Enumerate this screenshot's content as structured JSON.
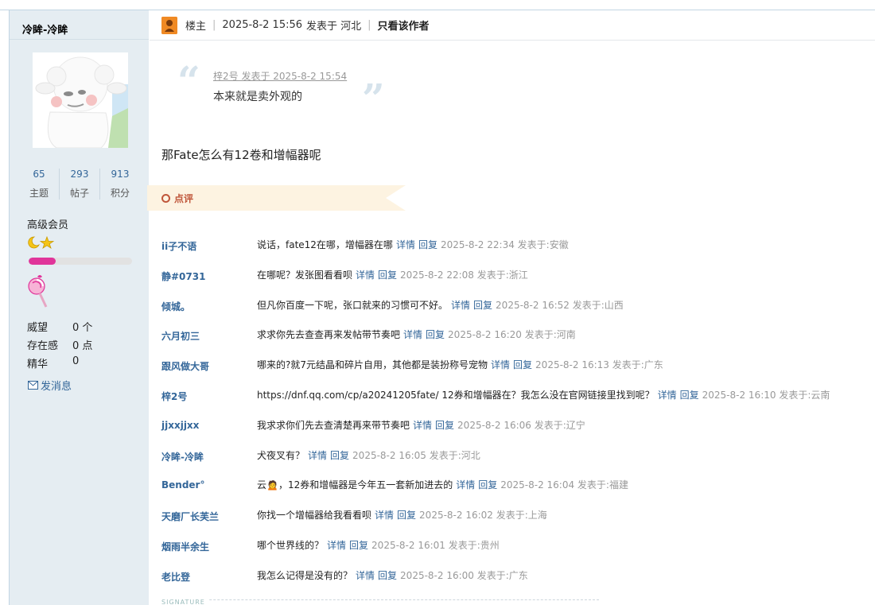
{
  "sidebar": {
    "username": "冷眸-冷眸",
    "stats": [
      {
        "value": "65",
        "label": "主题"
      },
      {
        "value": "293",
        "label": "帖子"
      },
      {
        "value": "913",
        "label": "积分"
      }
    ],
    "level": "高级会员",
    "progress_fraction": 0.26,
    "info": [
      {
        "key": "威望",
        "value": "0 个"
      },
      {
        "key": "存在感",
        "value": "0 点"
      },
      {
        "key": "精华",
        "value": "0"
      }
    ],
    "send_message": "发消息",
    "accent_color": "#e0359a"
  },
  "post_header": {
    "role": "楼主",
    "datetime": "2025-8-2 15:56",
    "posted_from": "发表于 河北",
    "only_author": "只看该作者"
  },
  "quote": {
    "meta": "梓2号 发表于 2025-8-2 15:54",
    "text": "本来就是卖外观的"
  },
  "post_text": "那Fate怎么有12卷和增幅器呢",
  "comment_tab": "点评",
  "comments": [
    {
      "user": "ii子不语",
      "text": "说话，fate12在哪，增幅器在哪",
      "detail": "详情",
      "reply": "回复",
      "time": "2025-8-2 22:34 发表于:安徽"
    },
    {
      "user": "静#0731",
      "text": "在哪呢？发张图看看呗",
      "detail": "详情",
      "reply": "回复",
      "time": "2025-8-2 22:08 发表于:浙江"
    },
    {
      "user": "倾城。",
      "text": "但凡你百度一下呢，张口就来的习惯可不好。",
      "detail": "详情",
      "reply": "回复",
      "time": "2025-8-2 16:52 发表于:山西"
    },
    {
      "user": "六月初三",
      "text": "求求你先去查查再来发帖带节奏吧",
      "detail": "详情",
      "reply": "回复",
      "time": "2025-8-2 16:20 发表于:河南"
    },
    {
      "user": "跟风做大哥",
      "text": "哪来的?就7元结晶和碎片自用，其他都是装扮称号宠物",
      "detail": "详情",
      "reply": "回复",
      "time": "2025-8-2 16:13 发表于:广东"
    },
    {
      "user": "梓2号",
      "text": "https://dnf.qq.com/cp/a20241205fate/ 12券和增幅器在？我怎么没在官网链接里找到呢？",
      "detail": "详情",
      "reply": "回复",
      "time": "2025-8-2 16:10 发表于:云南"
    },
    {
      "user": "jjxxjjxx",
      "text": "我求求你们先去查清楚再来带节奏吧",
      "detail": "详情",
      "reply": "回复",
      "time": "2025-8-2 16:06 发表于:辽宁"
    },
    {
      "user": "冷眸-冷眸",
      "text": "犬夜叉有？",
      "detail": "详情",
      "reply": "回复",
      "time": "2025-8-2 16:05 发表于:河北"
    },
    {
      "user": "Bender°",
      "text": "云🙍，12券和增幅器是今年五一套新加进去的",
      "detail": "详情",
      "reply": "回复",
      "time": "2025-8-2 16:04 发表于:福建"
    },
    {
      "user": "天磨厂长芙兰",
      "text": "你找一个增幅器给我看看呗",
      "detail": "详情",
      "reply": "回复",
      "time": "2025-8-2 16:02 发表于:上海"
    },
    {
      "user": "烟雨半余生",
      "text": "哪个世界线的？",
      "detail": "详情",
      "reply": "回复",
      "time": "2025-8-2 16:01 发表于:贵州"
    },
    {
      "user": "老比登",
      "text": "我怎么记得是没有的？",
      "detail": "详情",
      "reply": "回复",
      "time": "2025-8-2 16:00 发表于:广东"
    }
  ],
  "signature_label": "SIGNATURE"
}
